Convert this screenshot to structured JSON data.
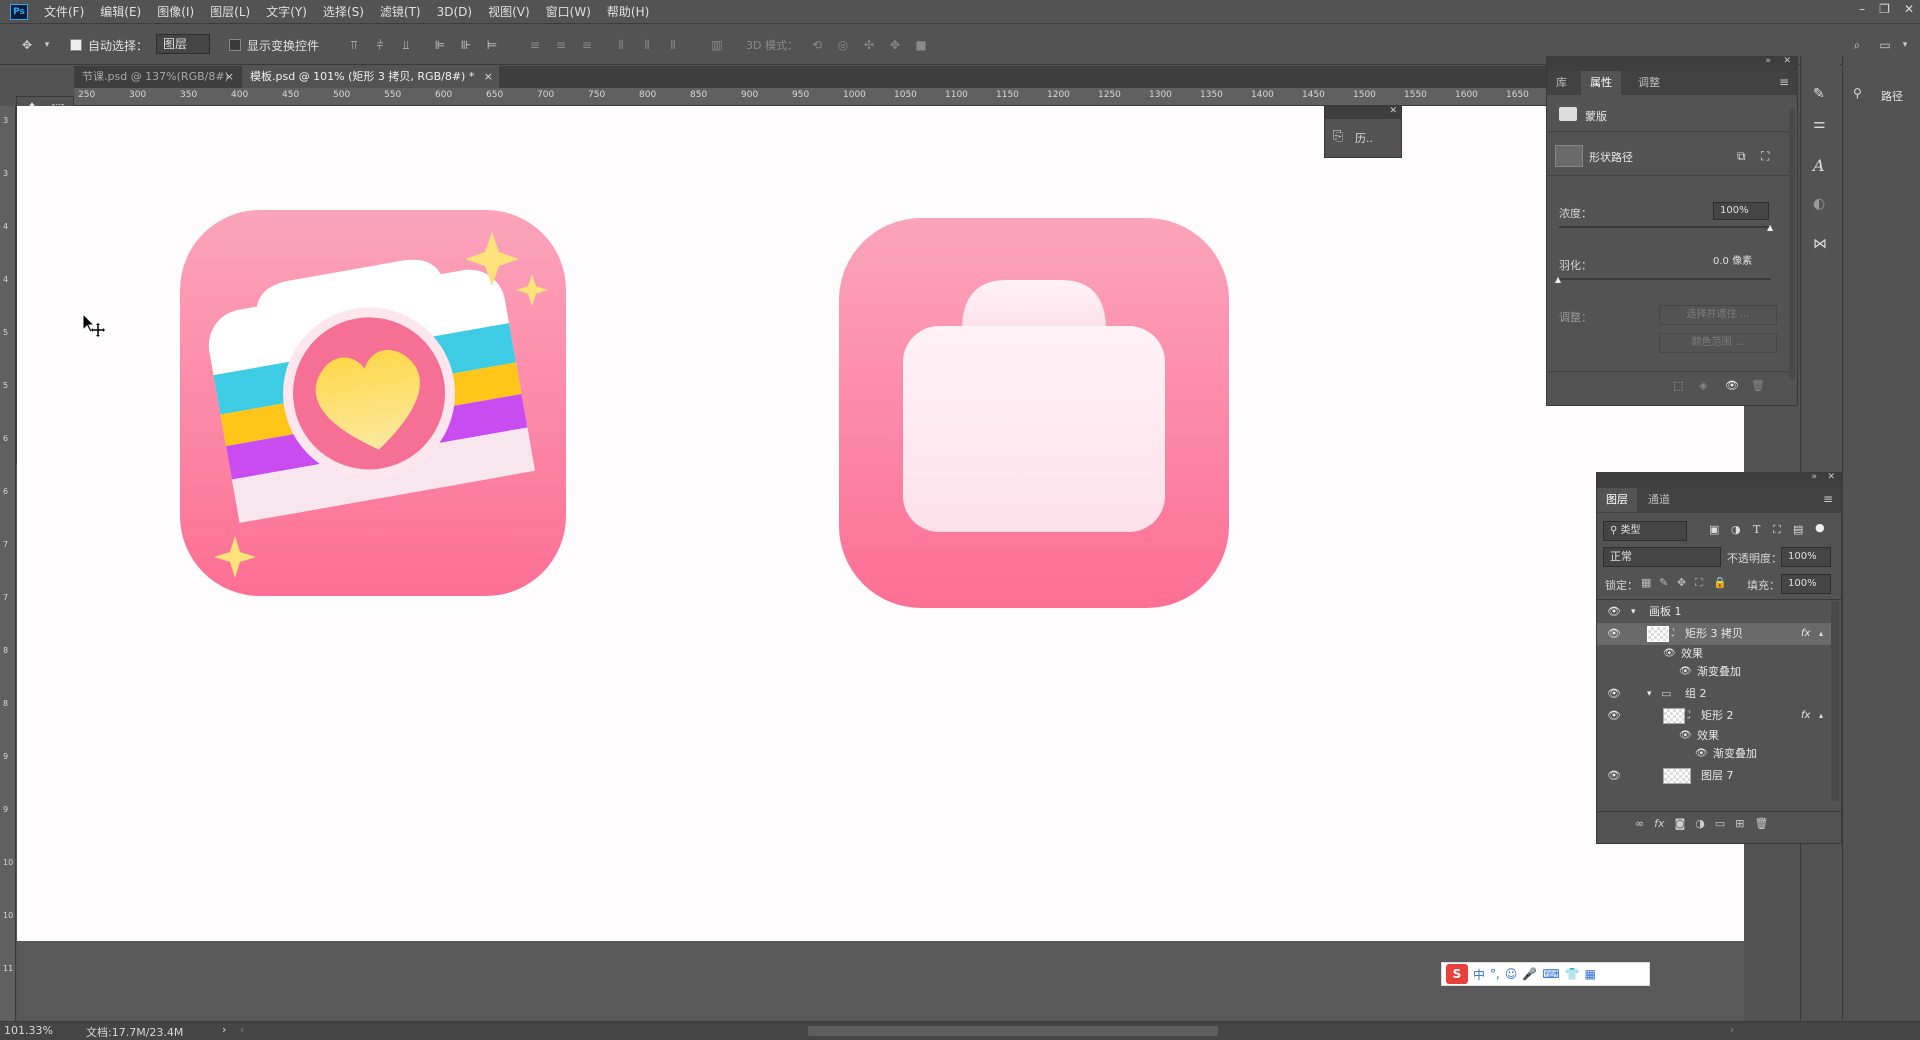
{
  "menubar": {
    "logo": "Ps",
    "items": [
      "文件(F)",
      "编辑(E)",
      "图像(I)",
      "图层(L)",
      "文字(Y)",
      "选择(S)",
      "滤镜(T)",
      "3D(D)",
      "视图(V)",
      "窗口(W)",
      "帮助(H)"
    ]
  },
  "options": {
    "auto_select_label": "自动选择：",
    "auto_select_value": "图层",
    "show_transform_label": "显示变换控件",
    "mode3d_label": "3D 模式："
  },
  "tabs": [
    {
      "label": "节课.psd @ 137%(RGB/8#)",
      "close": "×"
    },
    {
      "label": "模板.psd @ 101% (矩形 3 拷贝, RGB/8#) *",
      "close": "×"
    }
  ],
  "ruler_top": [
    "250",
    "300",
    "350",
    "400",
    "450",
    "500",
    "550",
    "600",
    "650",
    "700",
    "750",
    "800",
    "850",
    "900",
    "950",
    "1000",
    "1050",
    "1100",
    "1150",
    "1200",
    "1250",
    "1300",
    "1350",
    "1400",
    "1450",
    "1500",
    "1550",
    "1600",
    "1650"
  ],
  "ruler_left": [
    "3",
    "3",
    "4",
    "4",
    "5",
    "5",
    "6",
    "6",
    "7",
    "7",
    "8",
    "8",
    "9",
    "9",
    "10",
    "10",
    "11"
  ],
  "history_mini": {
    "label": "历.."
  },
  "properties": {
    "tabs": [
      "库",
      "属性",
      "调整"
    ],
    "mask_label": "蒙版",
    "shape_path_label": "形状路径",
    "density_label": "浓度：",
    "density_value": "100%",
    "feather_label": "羽化：",
    "feather_value": "0.0 像素",
    "adjust_label": "调整：",
    "select_and_mask_button": "选择并遮住 ...",
    "color_range_button": "颜色范围 ...",
    "density_fraction": 1.0,
    "feather_fraction": 0.0
  },
  "right_dock": {
    "paths_label": "路径"
  },
  "layers": {
    "tabs": [
      "图层",
      "通道"
    ],
    "filter_kind": "类型",
    "blend_mode": "正常",
    "opacity_label": "不透明度：",
    "opacity_value": "100%",
    "lock_label": "锁定：",
    "fill_label": "填充：",
    "fill_value": "100%",
    "rows": [
      {
        "name": "画板 1",
        "kind": "artboard"
      },
      {
        "name": "矩形 3 拷贝",
        "kind": "shape",
        "fx": "fx"
      },
      {
        "name": "效果",
        "kind": "effect"
      },
      {
        "name": "渐变叠加",
        "kind": "effect-item"
      },
      {
        "name": "组 2",
        "kind": "group"
      },
      {
        "name": "矩形 2",
        "kind": "shape",
        "fx": "fx"
      },
      {
        "name": "效果",
        "kind": "effect"
      },
      {
        "name": "渐变叠加",
        "kind": "effect-item"
      },
      {
        "name": "图层 7",
        "kind": "pixel"
      }
    ]
  },
  "ime": {
    "logo": "S",
    "lang": "中",
    "punct": "°,",
    "items": [
      "☺",
      "🎤",
      "⌨",
      "👕",
      "▦"
    ]
  },
  "status": {
    "zoom": "101.33%",
    "doc": "文档:17.7M/23.4M"
  },
  "colors": {
    "pink_top": "#fba4bc",
    "pink_bottom": "#fd6f94",
    "accent": "#3d7adf"
  }
}
